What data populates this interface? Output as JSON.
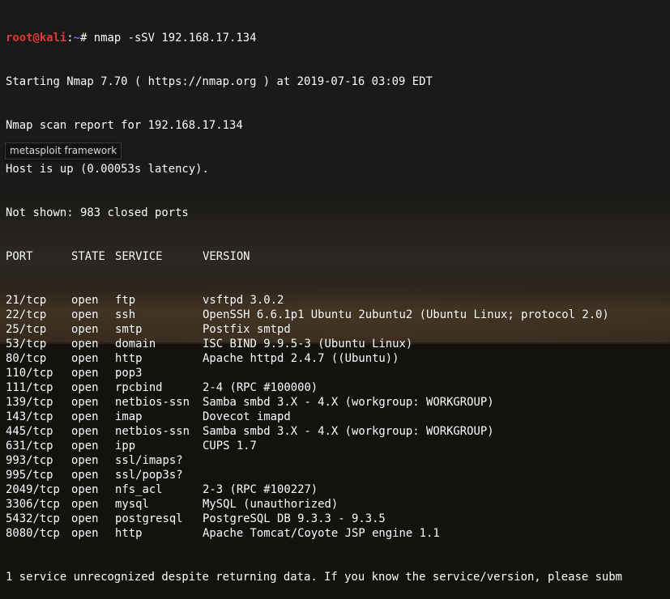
{
  "prompt": {
    "user_host": "root@kali",
    "separator": ":",
    "path": "~",
    "symbol": "# ",
    "command": "nmap -sSV 192.168.17.134"
  },
  "output_lines": [
    "Starting Nmap 7.70 ( https://nmap.org ) at 2019-07-16 03:09 EDT",
    "Nmap scan report for 192.168.17.134",
    "Host is up (0.00053s latency).",
    "Not shown: 983 closed ports"
  ],
  "table": {
    "headers": {
      "port": "PORT",
      "state": "STATE",
      "service": "SERVICE",
      "version": "VERSION"
    },
    "rows": [
      {
        "port": "21/tcp",
        "state": "open",
        "service": "ftp",
        "version": "vsftpd 3.0.2"
      },
      {
        "port": "22/tcp",
        "state": "open",
        "service": "ssh",
        "version": "OpenSSH 6.6.1p1 Ubuntu 2ubuntu2 (Ubuntu Linux; protocol 2.0)"
      },
      {
        "port": "25/tcp",
        "state": "open",
        "service": "smtp",
        "version": "Postfix smtpd"
      },
      {
        "port": "53/tcp",
        "state": "open",
        "service": "domain",
        "version": "ISC BIND 9.9.5-3 (Ubuntu Linux)"
      },
      {
        "port": "80/tcp",
        "state": "open",
        "service": "http",
        "version": "Apache httpd 2.4.7 ((Ubuntu))"
      },
      {
        "port": "110/tcp",
        "state": "open",
        "service": "pop3",
        "version": ""
      },
      {
        "port": "111/tcp",
        "state": "open",
        "service": "rpcbind",
        "version": "2-4 (RPC #100000)"
      },
      {
        "port": "139/tcp",
        "state": "open",
        "service": "netbios-ssn",
        "version": "Samba smbd 3.X - 4.X (workgroup: WORKGROUP)"
      },
      {
        "port": "143/tcp",
        "state": "open",
        "service": "imap",
        "version": "Dovecot imapd"
      },
      {
        "port": "445/tcp",
        "state": "open",
        "service": "netbios-ssn",
        "version": "Samba smbd 3.X - 4.X (workgroup: WORKGROUP)"
      },
      {
        "port": "631/tcp",
        "state": "open",
        "service": "ipp",
        "version": "CUPS 1.7"
      },
      {
        "port": "993/tcp",
        "state": "open",
        "service": "ssl/imaps?",
        "version": ""
      },
      {
        "port": "995/tcp",
        "state": "open",
        "service": "ssl/pop3s?",
        "version": ""
      },
      {
        "port": "2049/tcp",
        "state": "open",
        "service": "nfs_acl",
        "version": "2-3 (RPC #100227)"
      },
      {
        "port": "3306/tcp",
        "state": "open",
        "service": "mysql",
        "version": "MySQL (unauthorized)"
      },
      {
        "port": "5432/tcp",
        "state": "open",
        "service": "postgresql",
        "version": "PostgreSQL DB 9.3.3 - 9.3.5"
      },
      {
        "port": "8080/tcp",
        "state": "open",
        "service": "http",
        "version": "Apache Tomcat/Coyote JSP engine 1.1"
      }
    ]
  },
  "trailing_line": "1 service unrecognized despite returning data. If you know the service/version, please subm",
  "tooltip": {
    "text": "metasploit framework"
  }
}
